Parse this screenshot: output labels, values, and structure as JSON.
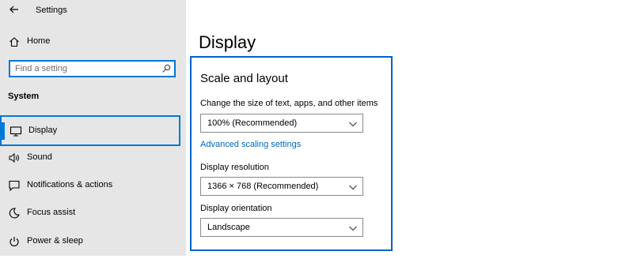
{
  "window": {
    "title": "Settings"
  },
  "sidebar": {
    "home_label": "Home",
    "search": {
      "placeholder": "Find a setting"
    },
    "section_title": "System",
    "items": [
      {
        "label": "Display",
        "icon": "monitor-icon",
        "selected": true
      },
      {
        "label": "Sound",
        "icon": "speaker-icon"
      },
      {
        "label": "Notifications & actions",
        "icon": "notification-icon"
      },
      {
        "label": "Focus assist",
        "icon": "moon-icon"
      },
      {
        "label": "Power & sleep",
        "icon": "power-icon"
      }
    ]
  },
  "main": {
    "page_title": "Display",
    "section": {
      "title": "Scale and layout",
      "scale_label": "Change the size of text, apps, and other items",
      "scale_value": "100% (Recommended)",
      "advanced_link": "Advanced scaling settings",
      "resolution_label": "Display resolution",
      "resolution_value": "1366 × 768 (Recommended)",
      "orientation_label": "Display orientation",
      "orientation_value": "Landscape"
    }
  },
  "colors": {
    "accent": "#0078d7",
    "link": "#0067c0",
    "sidebar_bg": "#e6e6e6"
  }
}
